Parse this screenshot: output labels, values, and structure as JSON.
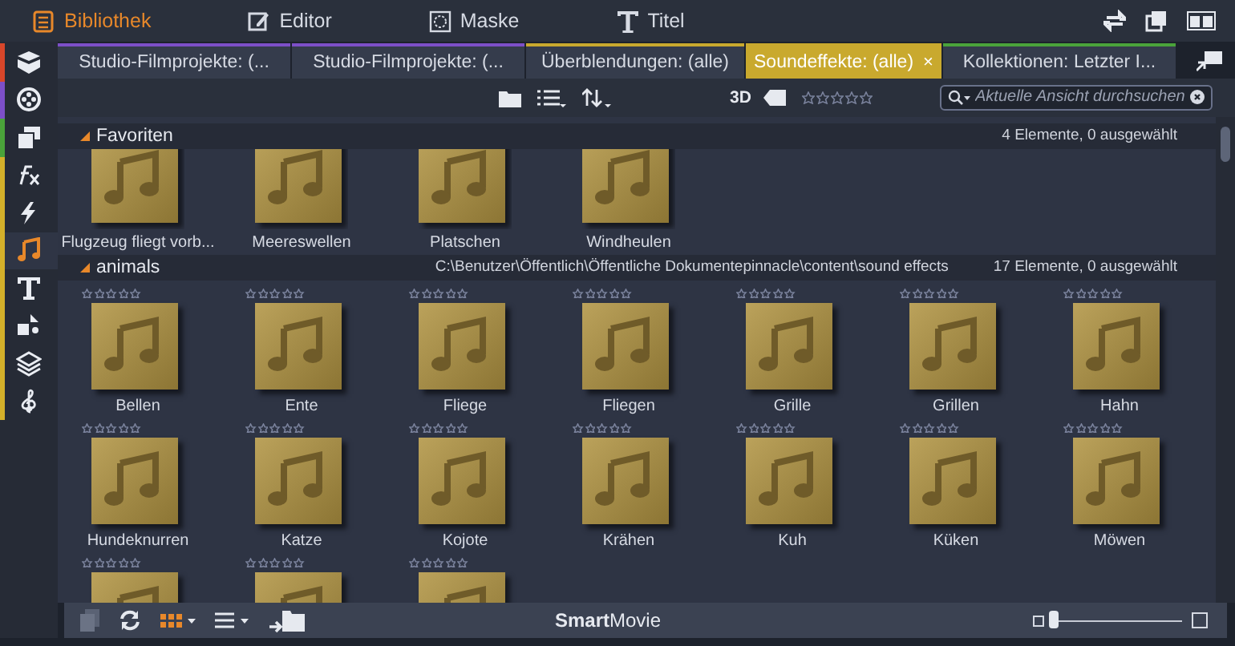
{
  "top_tabs": [
    {
      "label": "Bibliothek",
      "selected": true
    },
    {
      "label": "Editor",
      "selected": false
    },
    {
      "label": "Maske",
      "selected": false
    },
    {
      "label": "Titel",
      "selected": false
    }
  ],
  "sidebar": {
    "items": [
      {
        "color": "#d8462a",
        "selected": false
      },
      {
        "color": "#7d4fc8",
        "selected": false
      },
      {
        "color": "#4aa33a",
        "selected": false
      },
      {
        "color": "#d4b02a",
        "selected": false
      },
      {
        "color": "#d4b02a",
        "selected": false
      },
      {
        "color": "#d4b02a",
        "selected": true
      },
      {
        "color": "#d4b02a",
        "selected": false
      },
      {
        "color": "#d4b02a",
        "selected": false
      },
      {
        "color": "#d4b02a",
        "selected": false
      },
      {
        "color": "#d4b02a",
        "selected": false
      }
    ]
  },
  "tabs": [
    {
      "label": "Studio-Filmprojekte: (...",
      "color": "#7d4fc8",
      "selected": false
    },
    {
      "label": "Studio-Filmprojekte: (...",
      "color": "#7d4fc8",
      "selected": false
    },
    {
      "label": "Überblendungen: (alle)",
      "color": "#c9a92e",
      "selected": false
    },
    {
      "label": "Soundeffekte: (alle)",
      "color": "#c9a92e",
      "selected": true,
      "close": "×"
    },
    {
      "label": "Kollektionen: Letzter I...",
      "color": "#4aa33a",
      "selected": false
    }
  ],
  "toolbar": {
    "label_3d": "3D",
    "stars": 0,
    "search": {
      "placeholder": "Aktuelle Ansicht durchsuchen"
    }
  },
  "groups": [
    {
      "name": "Favoriten",
      "expanded": true,
      "count": "4 Elemente, 0 ausgewählt",
      "items": [
        {
          "name": "Flugzeug fliegt vorb..."
        },
        {
          "name": "Meereswellen"
        },
        {
          "name": "Platschen"
        },
        {
          "name": "Windheulen"
        }
      ]
    },
    {
      "name": "animals",
      "expanded": true,
      "path": "C:\\Benutzer\\Öffentlich\\Öffentliche Dokumentepinnacle\\content\\sound effects",
      "count": "17 Elemente, 0 ausgewählt",
      "items": [
        {
          "name": "Bellen",
          "stars": 0
        },
        {
          "name": "Ente",
          "stars": 0
        },
        {
          "name": "Fliege",
          "stars": 0
        },
        {
          "name": "Fliegen",
          "stars": 0
        },
        {
          "name": "Grille",
          "stars": 0
        },
        {
          "name": "Grillen",
          "stars": 0
        },
        {
          "name": "Hahn",
          "stars": 0
        },
        {
          "name": "Hundeknurren",
          "stars": 0
        },
        {
          "name": "Katze",
          "stars": 0
        },
        {
          "name": "Kojote",
          "stars": 0
        },
        {
          "name": "Krähen",
          "stars": 0
        },
        {
          "name": "Kuh",
          "stars": 0
        },
        {
          "name": "Küken",
          "stars": 0
        },
        {
          "name": "Möwen",
          "stars": 0
        },
        {
          "stars": 0
        },
        {
          "stars": 0
        },
        {
          "stars": 0
        }
      ]
    }
  ],
  "bottom_bar": {
    "title": "**Smart**Movie",
    "zoom": {
      "level": 0.0
    }
  }
}
